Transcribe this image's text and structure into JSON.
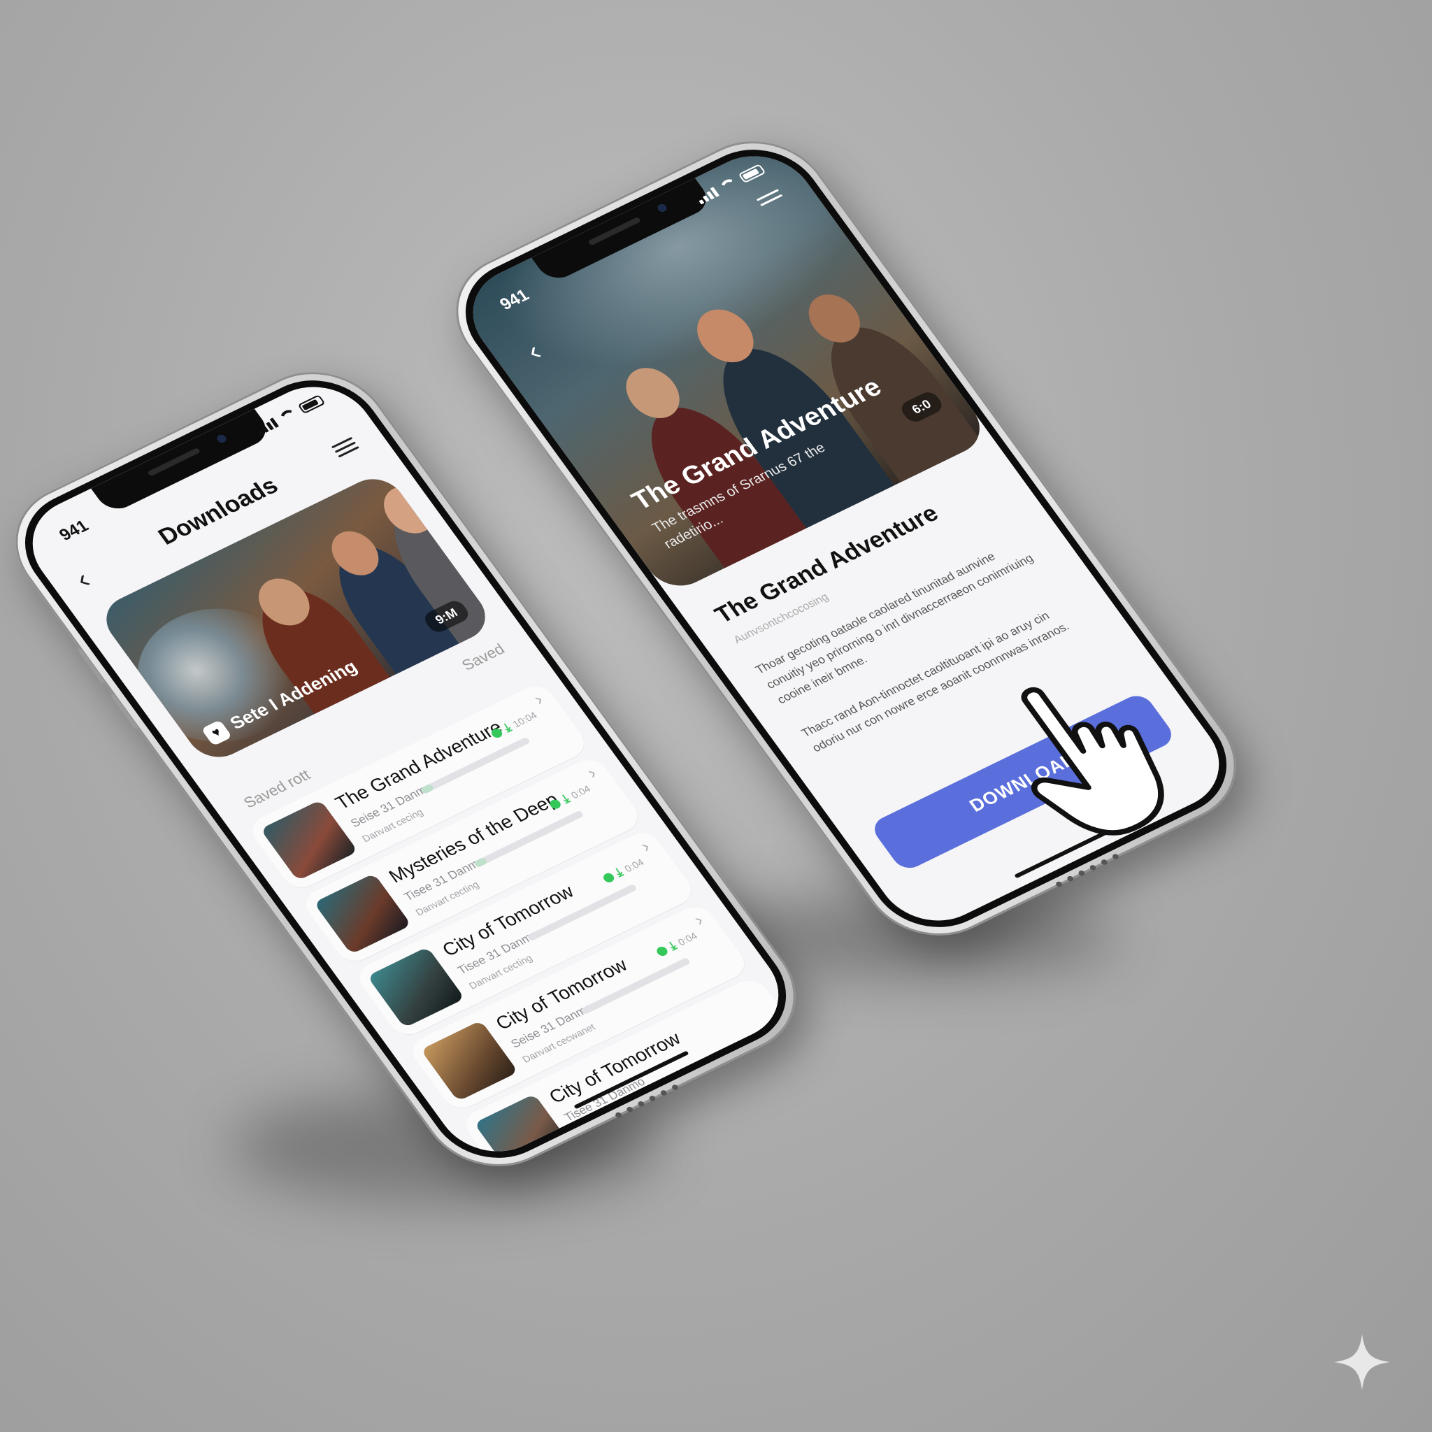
{
  "left_phone": {
    "status_time": "941",
    "header": {
      "title": "Downloads"
    },
    "hero": {
      "caption": "Sete I Addening",
      "duration": "9:M"
    },
    "saved_label": "Saved",
    "section_label": "Saved rott",
    "items": [
      {
        "title": "The Grand Adventure",
        "subtitle": "Seise 31 Danmo",
        "meta": "Danvart cecing",
        "time": "10:04",
        "progress": 0.1
      },
      {
        "title": "Mysteries of the Deep",
        "subtitle": "Tisee 31 Danmo",
        "meta": "Danvart cecting",
        "time": "0:04",
        "progress": 0.1
      },
      {
        "title": "City of Tomorrow",
        "subtitle": "Tisee 31 Danmo",
        "meta": "Danvart cecting",
        "time": "0:04",
        "progress": 0
      },
      {
        "title": "City of Tomorrow",
        "subtitle": "Seise 31 Danmo",
        "meta": "Danvart cecwanet",
        "time": "0:04",
        "progress": 0
      },
      {
        "title": "City of Tomorrow",
        "subtitle": "Tisee 31 Danmo",
        "meta": "",
        "time": "",
        "progress": 0
      }
    ]
  },
  "right_phone": {
    "status_time": "941",
    "hero": {
      "title": "The Grand Adventure",
      "subtitle": "The trasmns of Srarnus 67 the radetirio...",
      "badge": "6:0"
    },
    "detail": {
      "title": "The Grand Adventure",
      "meta": "Aunvsontchcocosing",
      "paragraph1": "Thoar gecoting oataole caolared tinunitad aunvine conuitiy yeo prirorning o inrl divnaccerraeon conimriuing cooine ineir bmne.",
      "paragraph2": "Thacc rand Aon-tinnoctet caoltituoant ipi ao aruy cin odoriu nur con nowre erce aoanit coonnnwas inranos."
    },
    "download_button": "DOWNLOAD"
  },
  "colors": {
    "accent_blue": "#5a6fdb",
    "status_green": "#34c759",
    "background": "#a9a9a9"
  },
  "icons": [
    "back-chevron-icon",
    "menu-icon",
    "cast-icon",
    "download-arrow-icon",
    "chevron-right-icon",
    "hand-pointer-icon",
    "sparkle-icon"
  ]
}
